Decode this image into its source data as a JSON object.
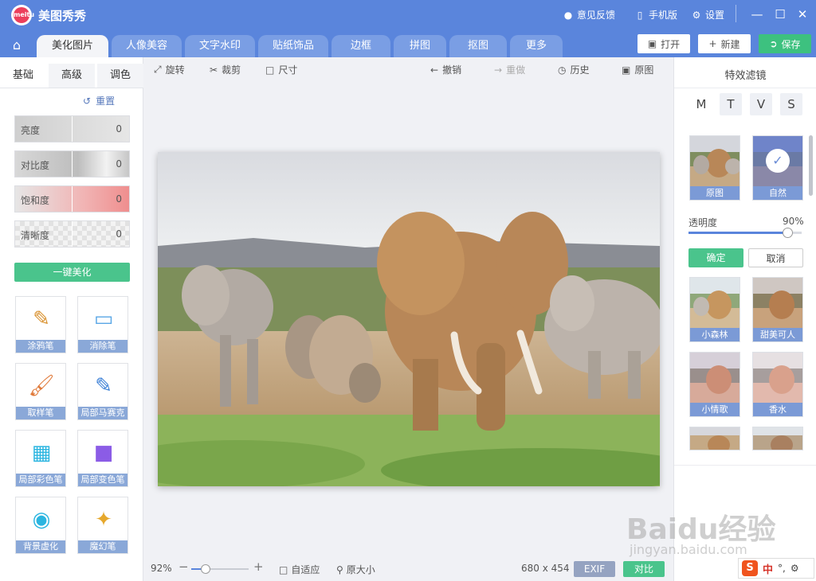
{
  "app": {
    "title": "美图秀秀",
    "logo_text": "meitu"
  },
  "titlebar": {
    "feedback": "意见反馈",
    "mobile": "手机版",
    "settings": "设置"
  },
  "tabs": [
    {
      "label": "美化图片",
      "active": true
    },
    {
      "label": "人像美容"
    },
    {
      "label": "文字水印"
    },
    {
      "label": "贴纸饰品"
    },
    {
      "label": "边框"
    },
    {
      "label": "拼图"
    },
    {
      "label": "抠图"
    },
    {
      "label": "更多"
    }
  ],
  "top_actions": {
    "open": "打开",
    "new": "新建",
    "save": "保存"
  },
  "left": {
    "subtabs": [
      "基础",
      "高级",
      "调色"
    ],
    "reset": "重置",
    "sliders": [
      {
        "label": "亮度",
        "value": "0"
      },
      {
        "label": "对比度",
        "value": "0"
      },
      {
        "label": "饱和度",
        "value": "0"
      },
      {
        "label": "清晰度",
        "value": "0"
      }
    ],
    "one_click": "一键美化",
    "tools": [
      "涂鸦笔",
      "消除笔",
      "取样笔",
      "局部马赛克",
      "局部彩色笔",
      "局部变色笔",
      "背景虚化",
      "魔幻笔"
    ]
  },
  "toolbar": {
    "rotate": "旋转",
    "crop": "裁剪",
    "size": "尺寸",
    "undo": "撤销",
    "redo": "重做",
    "history": "历史",
    "original": "原图"
  },
  "bottom": {
    "zoom": "92%",
    "fit": "自适应",
    "actual": "原大小",
    "dims": "680 x 454",
    "exif": "EXIF",
    "compare": "对比"
  },
  "right": {
    "title": "特效滤镜",
    "categories": [
      "M",
      "T",
      "V",
      "S"
    ],
    "filters": [
      {
        "label": "原图"
      },
      {
        "label": "自然",
        "selected": true
      },
      {
        "label": "小森林"
      },
      {
        "label": "甜美可人"
      },
      {
        "label": "小情歌"
      },
      {
        "label": "香水"
      }
    ],
    "opacity_label": "透明度",
    "opacity_value": "90%",
    "opacity": 0.9,
    "ok": "确定",
    "cancel": "取消"
  },
  "watermark": {
    "main": "Baidu经验",
    "sub": "jingyan.baidu.com"
  },
  "ime": {
    "mode": "中",
    "punct": "°,"
  },
  "colors": {
    "primary": "#5a85dc",
    "accent_green": "#4ac48c",
    "label_blue": "#8aa8d8"
  }
}
